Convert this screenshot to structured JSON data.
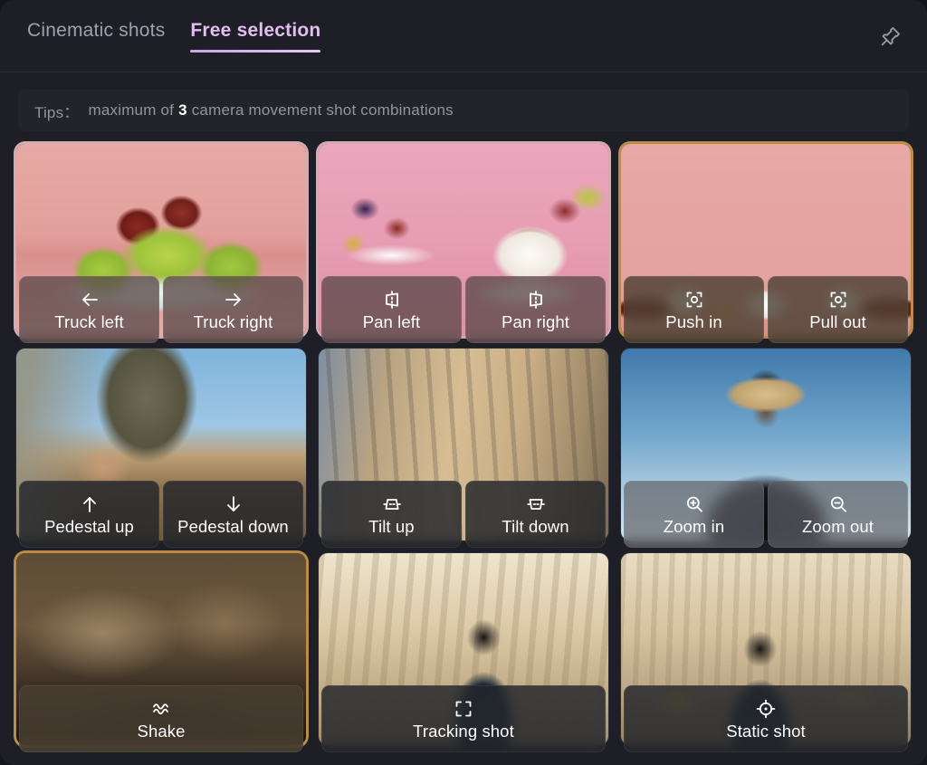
{
  "header": {
    "tabs": [
      {
        "label": "Cinematic shots",
        "active": false
      },
      {
        "label": "Free selection",
        "active": true
      }
    ],
    "pin_icon": "pushpin-icon"
  },
  "tips": {
    "label": "Tips：",
    "text_before": "maximum of",
    "count": "3",
    "text_after": "camera movement shot combinations"
  },
  "colors": {
    "panel_bg": "#1e1f26",
    "active_tab": "#e3bdf2",
    "inactive_tab": "#9ea0ab",
    "tips_bg": "#232429",
    "tips_text": "#92949e",
    "highlight_pink": "#f5c3cd",
    "highlight_amber": "#d6a04b"
  },
  "cards": [
    {
      "scene": "bowl-of-green-apples-and-strawberries",
      "glow": "pink",
      "tint": "warm",
      "actions": [
        {
          "label": "Truck left",
          "icon": "arrow-left-icon"
        },
        {
          "label": "Truck right",
          "icon": "arrow-right-icon"
        }
      ]
    },
    {
      "scene": "coffee-cup-and-fruit-plate",
      "glow": "pink",
      "tint": "warm",
      "actions": [
        {
          "label": "Pan left",
          "icon": "pan-left-icon"
        },
        {
          "label": "Pan right",
          "icon": "pan-right-icon"
        }
      ]
    },
    {
      "scene": "coffee-cups-row-on-pink-background",
      "glow": "amber",
      "tint": "brown",
      "actions": [
        {
          "label": "Push in",
          "icon": "focus-in-icon"
        },
        {
          "label": "Pull out",
          "icon": "focus-out-icon"
        }
      ]
    },
    {
      "scene": "cowboy-drawing-pistol-from-holster",
      "glow": "none",
      "tint": "dark",
      "actions": [
        {
          "label": "Pedestal up",
          "icon": "arrow-up-icon"
        },
        {
          "label": "Pedestal down",
          "icon": "arrow-down-icon"
        }
      ]
    },
    {
      "scene": "gothic-cathedral-facade",
      "glow": "none",
      "tint": "dark",
      "actions": [
        {
          "label": "Tilt up",
          "icon": "tilt-up-icon"
        },
        {
          "label": "Tilt down",
          "icon": "tilt-down-icon"
        }
      ]
    },
    {
      "scene": "cowboy-in-hat-against-blue-sky",
      "glow": "none",
      "tint": "grey",
      "actions": [
        {
          "label": "Zoom in",
          "icon": "magnifier-plus-icon"
        },
        {
          "label": "Zoom out",
          "icon": "magnifier-minus-icon"
        }
      ]
    },
    {
      "scene": "dusty-battlefield-smoke",
      "glow": "amber",
      "tint": "brown",
      "actions": [
        {
          "label": "Shake",
          "icon": "wave-lines-icon"
        }
      ]
    },
    {
      "scene": "man-in-suit-walking-city-street",
      "glow": "none",
      "tint": "dark",
      "actions": [
        {
          "label": "Tracking shot",
          "icon": "crop-brackets-icon"
        }
      ]
    },
    {
      "scene": "man-in-suit-with-taxis-crowd",
      "glow": "none",
      "tint": "dark",
      "actions": [
        {
          "label": "Static shot",
          "icon": "crosshair-icon"
        }
      ]
    }
  ]
}
